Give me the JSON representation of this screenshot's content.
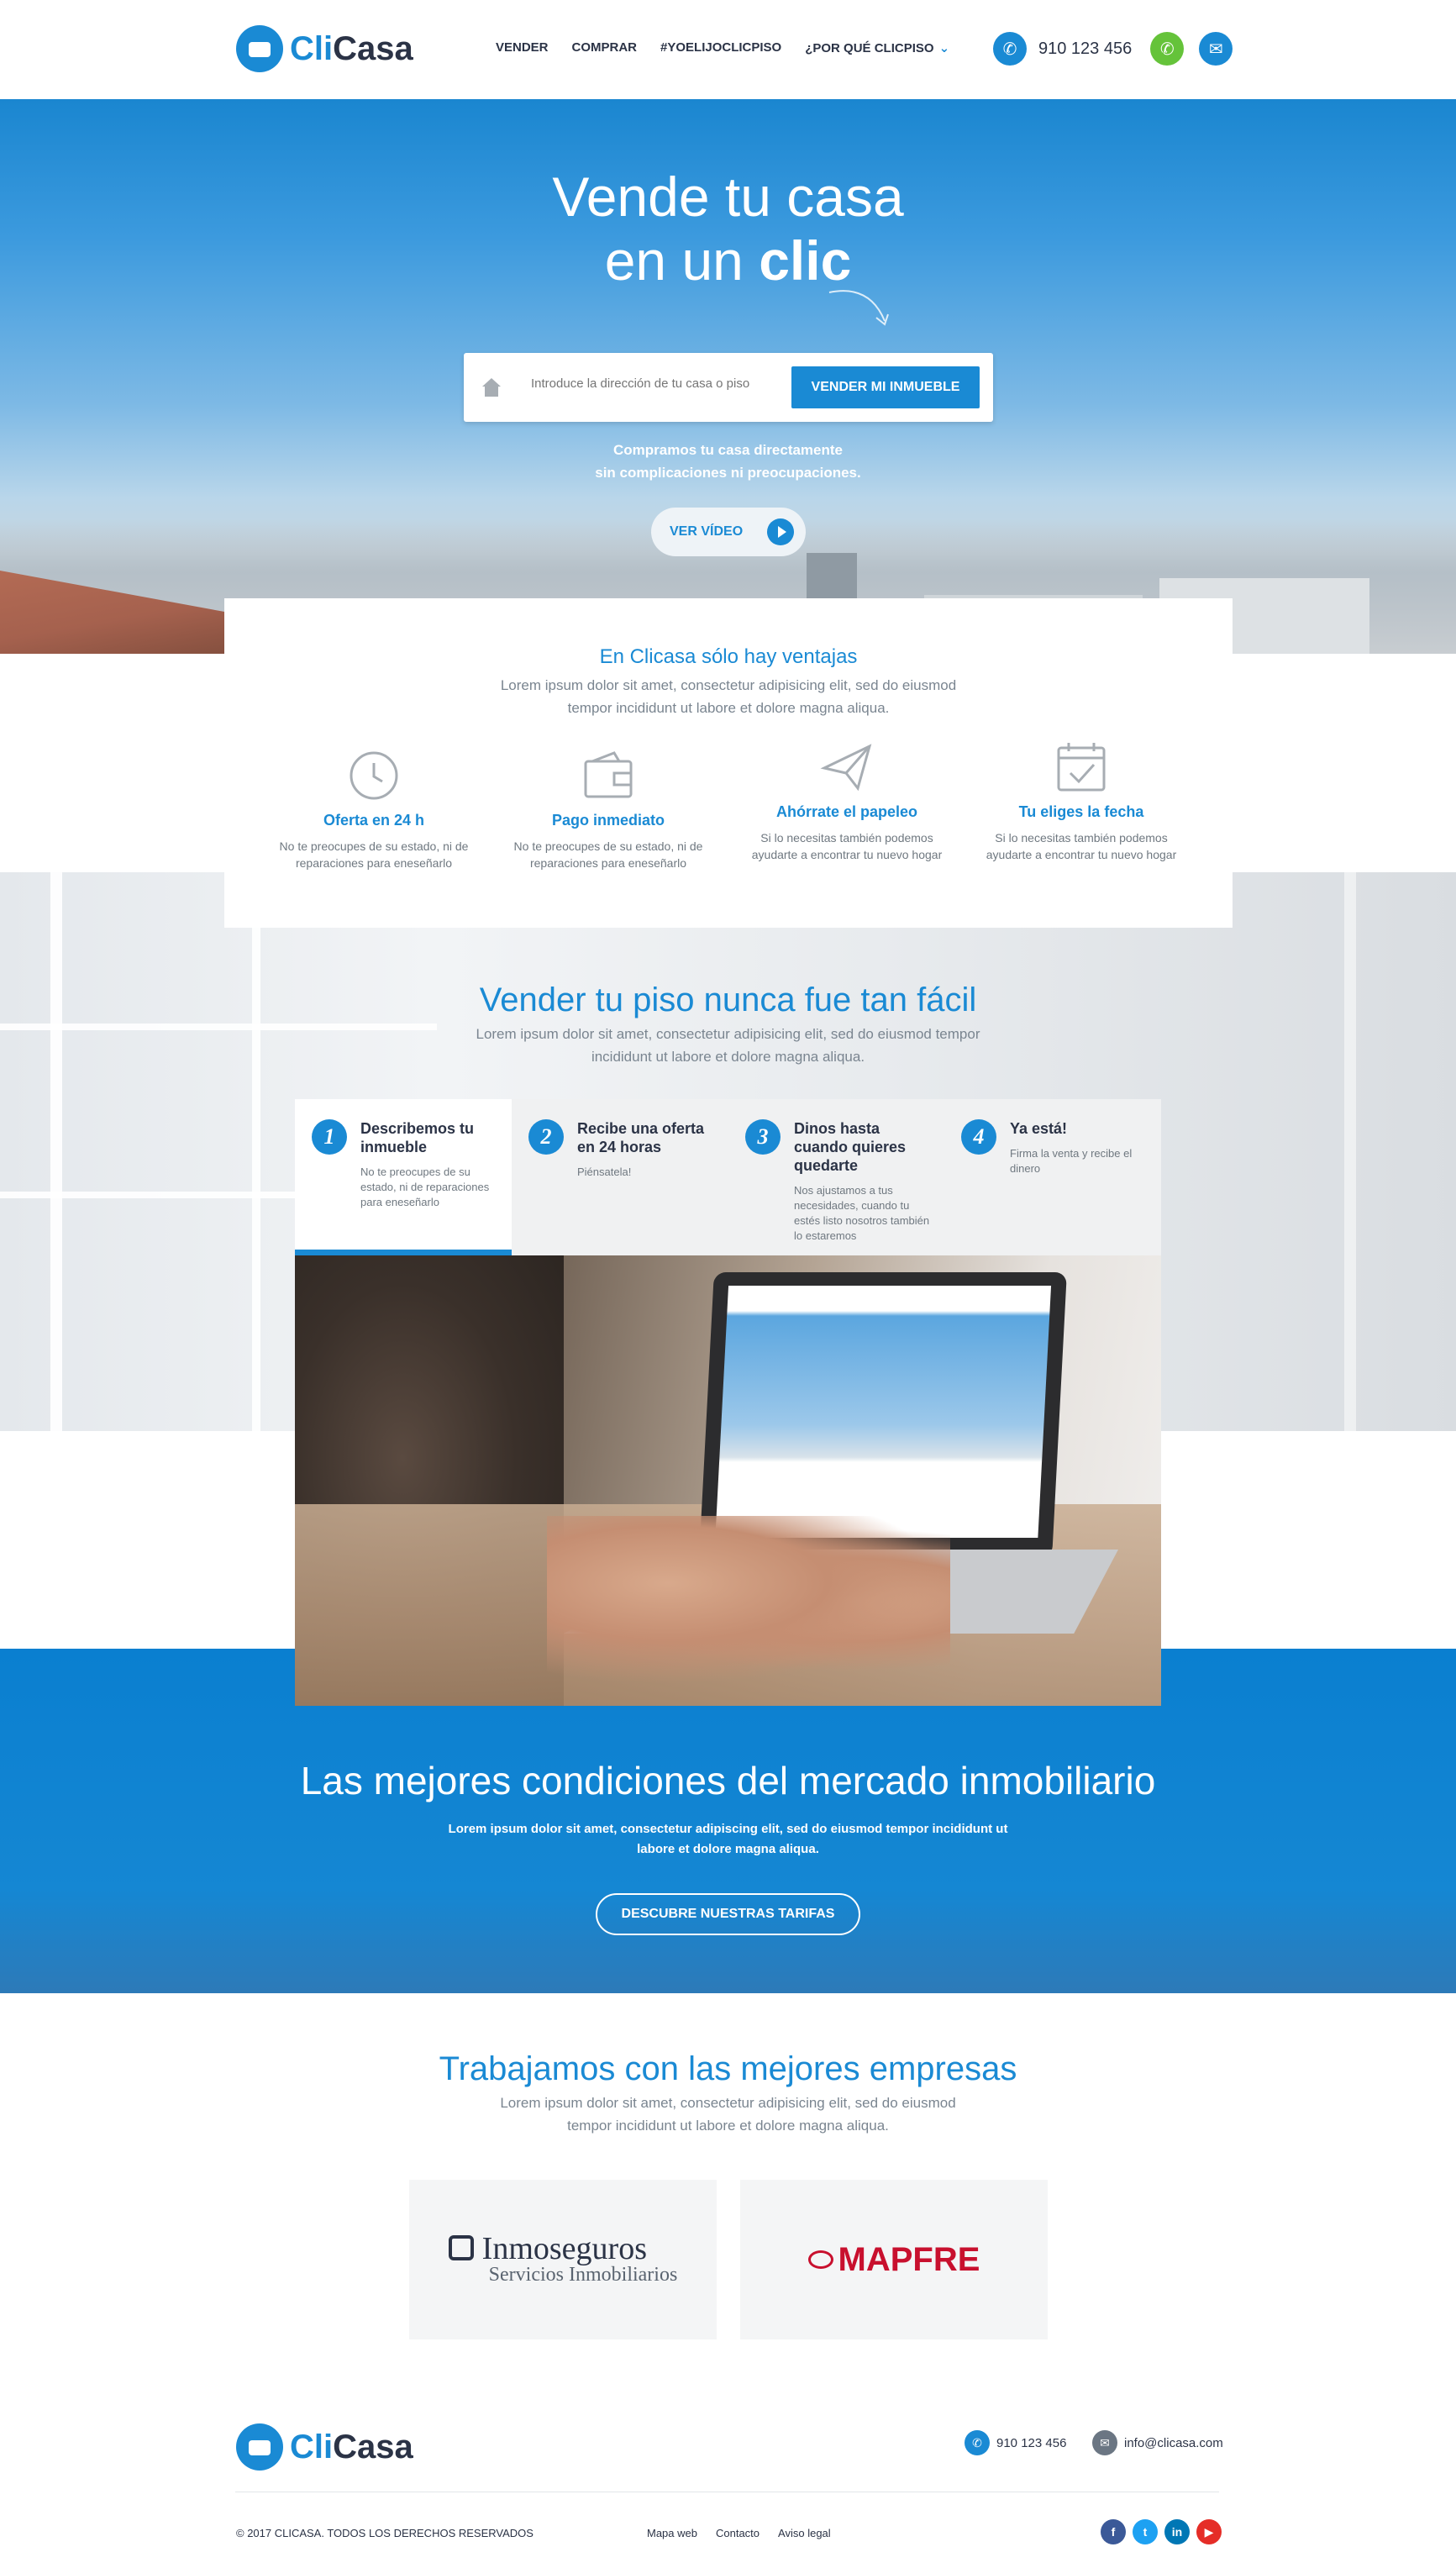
{
  "header": {
    "logo": {
      "part1": "Cli",
      "part2": "Casa"
    },
    "nav": [
      {
        "label": "VENDER"
      },
      {
        "label": "COMPRAR"
      },
      {
        "label": "#YOELIJOCLICPISO"
      },
      {
        "label": "¿POR QUÉ CLICPISO"
      }
    ],
    "phone": "910 123 456"
  },
  "hero": {
    "title_line1": "Vende tu casa",
    "title_line2_pre": "en un ",
    "title_line2_bold": "clic",
    "search_placeholder": "Introduce la dirección de tu casa o piso",
    "sell_button": "VENDER MI INMUEBLE",
    "subtitle_line1": "Compramos tu casa directamente",
    "subtitle_line2": "sin complicaciones ni preocupaciones.",
    "video_button": "VER VÍDEO"
  },
  "advantages": {
    "title": "En Clicasa sólo hay ventajas",
    "subtitle_line1": "Lorem ipsum dolor sit amet, consectetur adipisicing elit, sed do eiusmod",
    "subtitle_line2": "tempor incididunt ut labore et dolore magna aliqua.",
    "items": [
      {
        "icon": "clock-icon",
        "title": "Oferta en 24 h",
        "text": "No te preocupes de su estado, ni de reparaciones para eneseñarlo"
      },
      {
        "icon": "wallet-icon",
        "title": "Pago inmediato",
        "text": "No te preocupes de su estado, ni de reparaciones para eneseñarlo"
      },
      {
        "icon": "paper-plane-icon",
        "title": "Ahórrate el papeleo",
        "text": "Si lo necesitas también podemos ayudarte a encontrar tu nuevo hogar"
      },
      {
        "icon": "calendar-check-icon",
        "title": "Tu eliges la fecha",
        "text": "Si lo necesitas también podemos ayudarte a encontrar tu nuevo hogar"
      }
    ]
  },
  "steps": {
    "title": "Vender tu piso nunca fue tan fácil",
    "subtitle_line1": "Lorem ipsum dolor sit amet, consectetur adipisicing elit, sed do eiusmod tempor",
    "subtitle_line2": "incididunt ut labore et dolore magna aliqua.",
    "items": [
      {
        "num": "1",
        "title": "Describemos tu inmueble",
        "text": "No te preocupes de su estado, ni de reparaciones para eneseñarlo"
      },
      {
        "num": "2",
        "title": "Recibe una oferta en 24 horas",
        "text": "Piénsatela!"
      },
      {
        "num": "3",
        "title": "Dinos hasta cuando quieres quedarte",
        "text": "Nos ajustamos a tus necesidades, cuando tu estés listo nosotros también lo estaremos"
      },
      {
        "num": "4",
        "title": "Ya está!",
        "text": "Firma la venta y recibe el dinero"
      }
    ]
  },
  "banner": {
    "title": "Las mejores condiciones del mercado inmobiliario",
    "subtitle_line1": "Lorem ipsum dolor sit amet, consectetur adipiscing elit, sed do eiusmod tempor incididunt ut",
    "subtitle_line2": "labore et dolore magna aliqua.",
    "button": "DESCUBRE NUESTRAS TARIFAS"
  },
  "partners": {
    "title": "Trabajamos con las mejores empresas",
    "subtitle_line1": "Lorem ipsum dolor sit amet, consectetur adipisicing elit, sed do eiusmod",
    "subtitle_line2": "tempor incididunt ut labore et dolore magna aliqua.",
    "logos": [
      {
        "name": "Inmoseguros",
        "tagline": "Servicios Inmobiliarios"
      },
      {
        "name": "MAPFRE"
      }
    ]
  },
  "footer": {
    "phone": "910 123 456",
    "email": "info@clicasa.com",
    "copyright": "© 2017 CLICASA. TODOS LOS DERECHOS RESERVADOS",
    "links": [
      "Mapa web",
      "Contacto",
      "Aviso legal"
    ],
    "social": [
      {
        "icon": "facebook-icon",
        "glyph": "f",
        "color": "#3b5998"
      },
      {
        "icon": "twitter-icon",
        "glyph": "t",
        "color": "#1da1f2"
      },
      {
        "icon": "linkedin-icon",
        "glyph": "in",
        "color": "#0077b5"
      },
      {
        "icon": "youtube-icon",
        "glyph": "▶",
        "color": "#e52d27"
      }
    ]
  },
  "colors": {
    "brand": "#1a8ad4",
    "dark": "#2b3346",
    "whatsapp": "#65c33a"
  }
}
